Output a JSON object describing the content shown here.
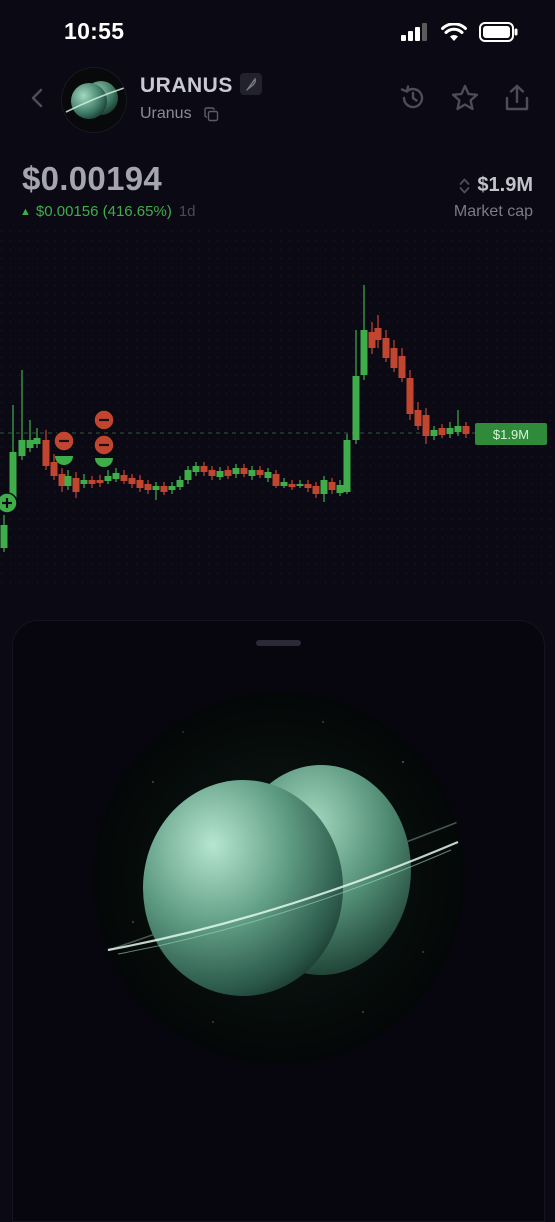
{
  "status_bar": {
    "time": "10:55"
  },
  "header": {
    "token_name": "URANUS",
    "token_subtitle": "Uranus",
    "back_icon": "chevron-left-icon",
    "actions": [
      "history-icon",
      "star-icon",
      "share-icon"
    ]
  },
  "price": {
    "current": "$0.00194",
    "change": "$0.00156 (416.65%)",
    "period": "1d",
    "direction": "up"
  },
  "market_cap": {
    "value": "$1.9M",
    "label": "Market cap"
  },
  "chart_data": {
    "type": "candlestick",
    "price_label": "$1.9M",
    "colors": {
      "up": "#3fae4a",
      "down": "#c2452f",
      "marker_sell": "#c2452f",
      "marker_buy": "#3fae4a"
    },
    "trade_markers": [
      "buy",
      "sell",
      "sell",
      "sell",
      "sell"
    ]
  },
  "colors": {
    "accent_green": "#3fae4a",
    "accent_red": "#c2452f",
    "background": "#0b0a14"
  }
}
